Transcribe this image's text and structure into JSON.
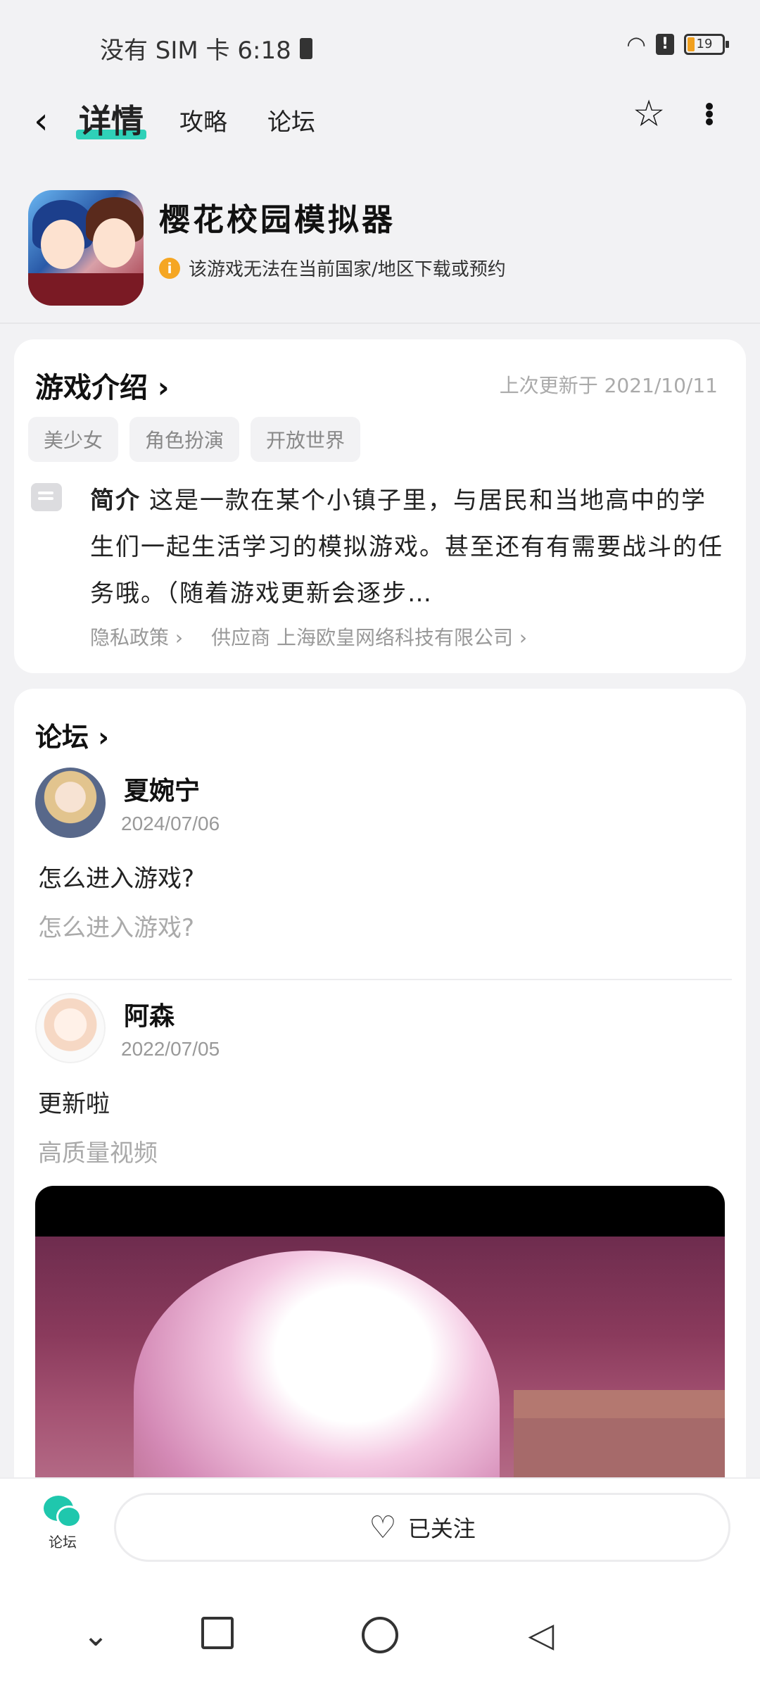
{
  "status": {
    "carrier_time": "没有 SIM 卡 6:18",
    "battery_level": "19"
  },
  "nav": {
    "tabs": [
      {
        "label": "详情",
        "active": true
      },
      {
        "label": "攻略",
        "active": false
      },
      {
        "label": "论坛",
        "active": false
      }
    ]
  },
  "app": {
    "title": "樱花校园模拟器",
    "warning": "该游戏无法在当前国家/地区下载或预约"
  },
  "intro": {
    "title": "游戏介绍 ›",
    "updated": "上次更新于 2021/10/11",
    "tags": [
      "美少女",
      "角色扮演",
      "开放世界"
    ],
    "desc_label": "简介",
    "desc_text": "这是一款在某个小镇子里，与居民和当地高中的学生们一起生活学习的模拟游戏。甚至还有有需要战斗的任务哦。（随着游戏更新会逐步…",
    "privacy_link": "隐私政策 ›",
    "provider_link": "供应商 上海欧皇网络科技有限公司 ›"
  },
  "forum": {
    "title": "论坛 ›",
    "posts": [
      {
        "author": "夏婉宁",
        "date": "2024/07/06",
        "title": "怎么进入游戏?",
        "body": "怎么进入游戏?"
      },
      {
        "author": "阿森",
        "date": "2022/07/05",
        "title": "更新啦",
        "body": "高质量视频"
      }
    ]
  },
  "bottom_bar": {
    "forum_label": "论坛",
    "follow_label": "已关注"
  },
  "colors": {
    "accent": "#2fd1b8",
    "warning": "#f5a623",
    "forum_icon": "#1fc7ad"
  },
  "icons": {
    "back": "chevron-left-icon",
    "favorite": "star-plus-icon",
    "more": "more-vertical-icon",
    "info": "info-icon",
    "desc": "document-icon",
    "follow": "heart-check-icon"
  }
}
